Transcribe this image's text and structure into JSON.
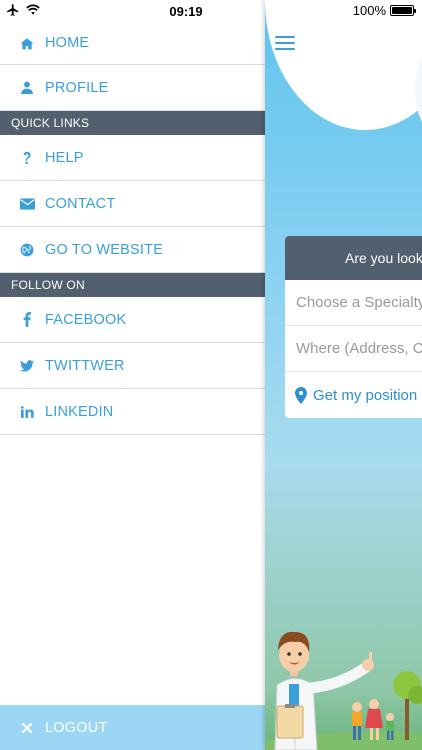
{
  "status_bar": {
    "time": "09:19",
    "battery": "100%",
    "battery_level": 1.0
  },
  "drawer": {
    "items": [
      {
        "label": "HOME",
        "icon": "home-icon"
      },
      {
        "label": "PROFILE",
        "icon": "user-icon"
      }
    ],
    "quick_links_header": "QUICK LINKS",
    "quick_links": [
      {
        "label": "HELP",
        "icon": "question-icon"
      },
      {
        "label": "CONTACT",
        "icon": "envelope-icon"
      },
      {
        "label": "GO TO WEBSITE",
        "icon": "globe-icon"
      }
    ],
    "follow_header": "FOLLOW ON",
    "follow_links": [
      {
        "label": "FACEBOOK",
        "icon": "facebook-icon"
      },
      {
        "label": "TWITTWER",
        "icon": "twitter-icon"
      },
      {
        "label": "LINKEDIN",
        "icon": "linkedin-icon"
      }
    ],
    "logout_label": "LOGOUT"
  },
  "main": {
    "card_title": "Are you looki",
    "specialty_placeholder": "Choose a Specialty",
    "where_placeholder": "Where (Address, C",
    "position_label": "Get my position"
  },
  "colors": {
    "accent": "#3a9fd9",
    "section_header": "#525f6e",
    "logout_bg": "#9bd7f5"
  }
}
